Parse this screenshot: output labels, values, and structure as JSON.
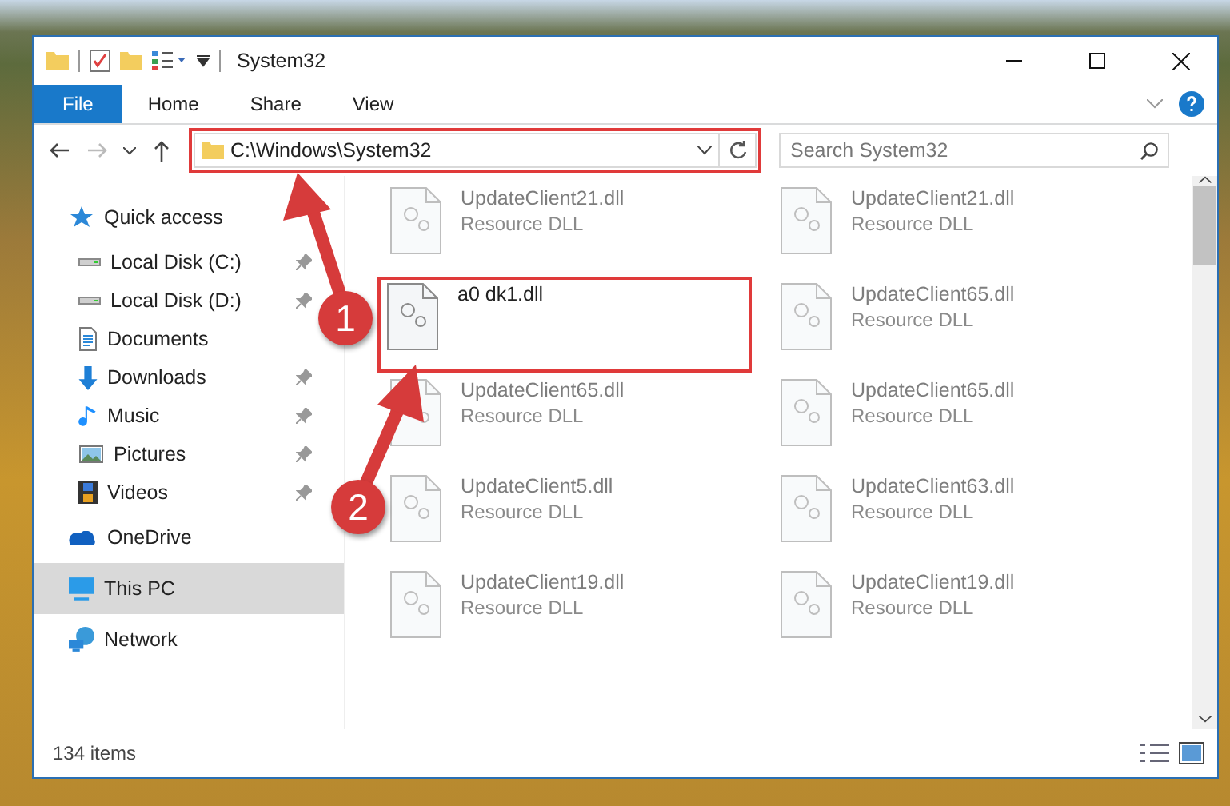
{
  "window": {
    "title": "System32"
  },
  "ribbon_tabs": [
    {
      "label": "File",
      "selected": true
    },
    {
      "label": "Home",
      "selected": false
    },
    {
      "label": "Share",
      "selected": false
    },
    {
      "label": "View",
      "selected": false
    }
  ],
  "address_bar": {
    "value": "C:\\Windows\\System32",
    "highlighted": true
  },
  "search": {
    "placeholder": "Search System32"
  },
  "sidebar": {
    "items": [
      {
        "label": "Quick access",
        "kind": "star",
        "selected": false,
        "children": [
          {
            "label": "Local Disk (C:)",
            "kind": "drive",
            "pinned": true,
            "selected": false
          },
          {
            "label": "Local Disk (D:)",
            "kind": "drive",
            "pinned": true,
            "selected": false
          },
          {
            "label": "Documents",
            "kind": "documents",
            "pinned": false,
            "selected": false
          },
          {
            "label": "Downloads",
            "kind": "downloads",
            "pinned": true,
            "selected": false
          },
          {
            "label": "Music",
            "kind": "music",
            "pinned": true,
            "selected": false
          },
          {
            "label": "Pictures",
            "kind": "pictures",
            "pinned": true,
            "selected": false
          },
          {
            "label": "Videos",
            "kind": "videos",
            "pinned": true,
            "selected": false
          }
        ]
      },
      {
        "label": "OneDrive",
        "kind": "cloud",
        "selected": false
      },
      {
        "label": "This PC",
        "kind": "computer",
        "selected": true
      },
      {
        "label": "Network",
        "kind": "network",
        "selected": false
      }
    ]
  },
  "files": [
    {
      "name": "UpdateClient21.dll",
      "type": "Resource DLL",
      "blurred": true,
      "highlighted": false
    },
    {
      "name": "UpdateClient21.dll",
      "type": "Resource DLL",
      "blurred": true,
      "highlighted": false
    },
    {
      "name": "a0 dk1.dll",
      "blurred": false,
      "highlighted": true
    },
    {
      "name": "UpdateClient65.dll",
      "type": "Resource DLL",
      "blurred": true,
      "highlighted": false
    },
    {
      "name": "UpdateClient65.dll",
      "type": "Resource DLL",
      "blurred": true,
      "highlighted": false
    },
    {
      "name": "UpdateClient65.dll",
      "type": "Resource DLL",
      "blurred": true,
      "highlighted": false
    },
    {
      "name": "UpdateClient5.dll",
      "type": "Resource DLL",
      "blurred": true,
      "highlighted": false
    },
    {
      "name": "UpdateClient63.dll",
      "type": "Resource DLL",
      "blurred": true,
      "highlighted": false
    },
    {
      "name": "UpdateClient19.dll",
      "type": "Resource DLL",
      "blurred": true,
      "highlighted": false
    },
    {
      "name": "UpdateClient19.dll",
      "type": "Resource DLL",
      "blurred": true,
      "highlighted": false
    }
  ],
  "status_bar": {
    "item_count": "134 items"
  },
  "annotations": [
    {
      "label": "1"
    },
    {
      "label": "2"
    }
  ]
}
